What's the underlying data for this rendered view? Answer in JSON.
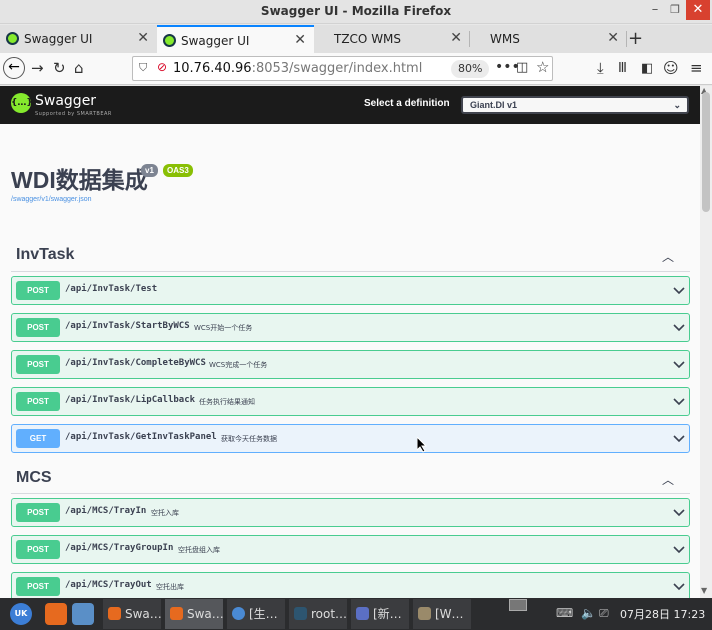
{
  "window": {
    "title": "Swagger UI - Mozilla Firefox"
  },
  "tabs": [
    {
      "label": "Swagger UI",
      "active": false,
      "favicon": "swagger-icon"
    },
    {
      "label": "Swagger UI",
      "active": true,
      "favicon": "swagger-icon"
    },
    {
      "label": "TZCO WMS",
      "active": false
    },
    {
      "label": "WMS",
      "active": false
    }
  ],
  "address_bar": {
    "host": "10.76.40.96",
    "rest": ":8053/swagger/index.html",
    "zoom": "80%"
  },
  "swagger": {
    "logo_text": "Swagger",
    "logo_sub": "Supported by SMARTBEAR",
    "definition_label": "Select a definition",
    "definition_value": "Giant.DI v1",
    "title": "WDI数据集成",
    "version_badge": "v1",
    "oas_badge": "OAS3",
    "spec_link": "/swagger/v1/swagger.json",
    "tags": [
      {
        "name": "InvTask",
        "operations": [
          {
            "method": "POST",
            "path": "/api/InvTask/Test",
            "summary": ""
          },
          {
            "method": "POST",
            "path": "/api/InvTask/StartByWCS",
            "summary": "WCS开始一个任务"
          },
          {
            "method": "POST",
            "path": "/api/InvTask/CompleteByWCS",
            "summary": "WCS完成一个任务"
          },
          {
            "method": "POST",
            "path": "/api/InvTask/LipCallback",
            "summary": "任务执行结果通知"
          },
          {
            "method": "GET",
            "path": "/api/InvTask/GetInvTaskPanel",
            "summary": "获取今天任务数据"
          }
        ]
      },
      {
        "name": "MCS",
        "operations": [
          {
            "method": "POST",
            "path": "/api/MCS/TrayIn",
            "summary": "空托入库"
          },
          {
            "method": "POST",
            "path": "/api/MCS/TrayGroupIn",
            "summary": "空托盘组入库"
          },
          {
            "method": "POST",
            "path": "/api/MCS/TrayOut",
            "summary": "空托出库"
          }
        ]
      }
    ]
  },
  "taskbar": {
    "items": [
      {
        "label": "Swa…",
        "active": false
      },
      {
        "label": "Swa…",
        "active": true
      },
      {
        "label": "[生…",
        "active": false
      },
      {
        "label": "root…",
        "active": false
      },
      {
        "label": "[新…",
        "active": false
      },
      {
        "label": "[W…",
        "active": false
      }
    ],
    "clock": "07月28日 17:23"
  },
  "colors": {
    "post": "#49cc90",
    "post_bg": "#e8f6f0",
    "get": "#61affe",
    "get_bg": "#ebf3fb",
    "swagger_green": "#85ea2d",
    "topbar": "#1b1b1b",
    "text": "#3b4151"
  }
}
